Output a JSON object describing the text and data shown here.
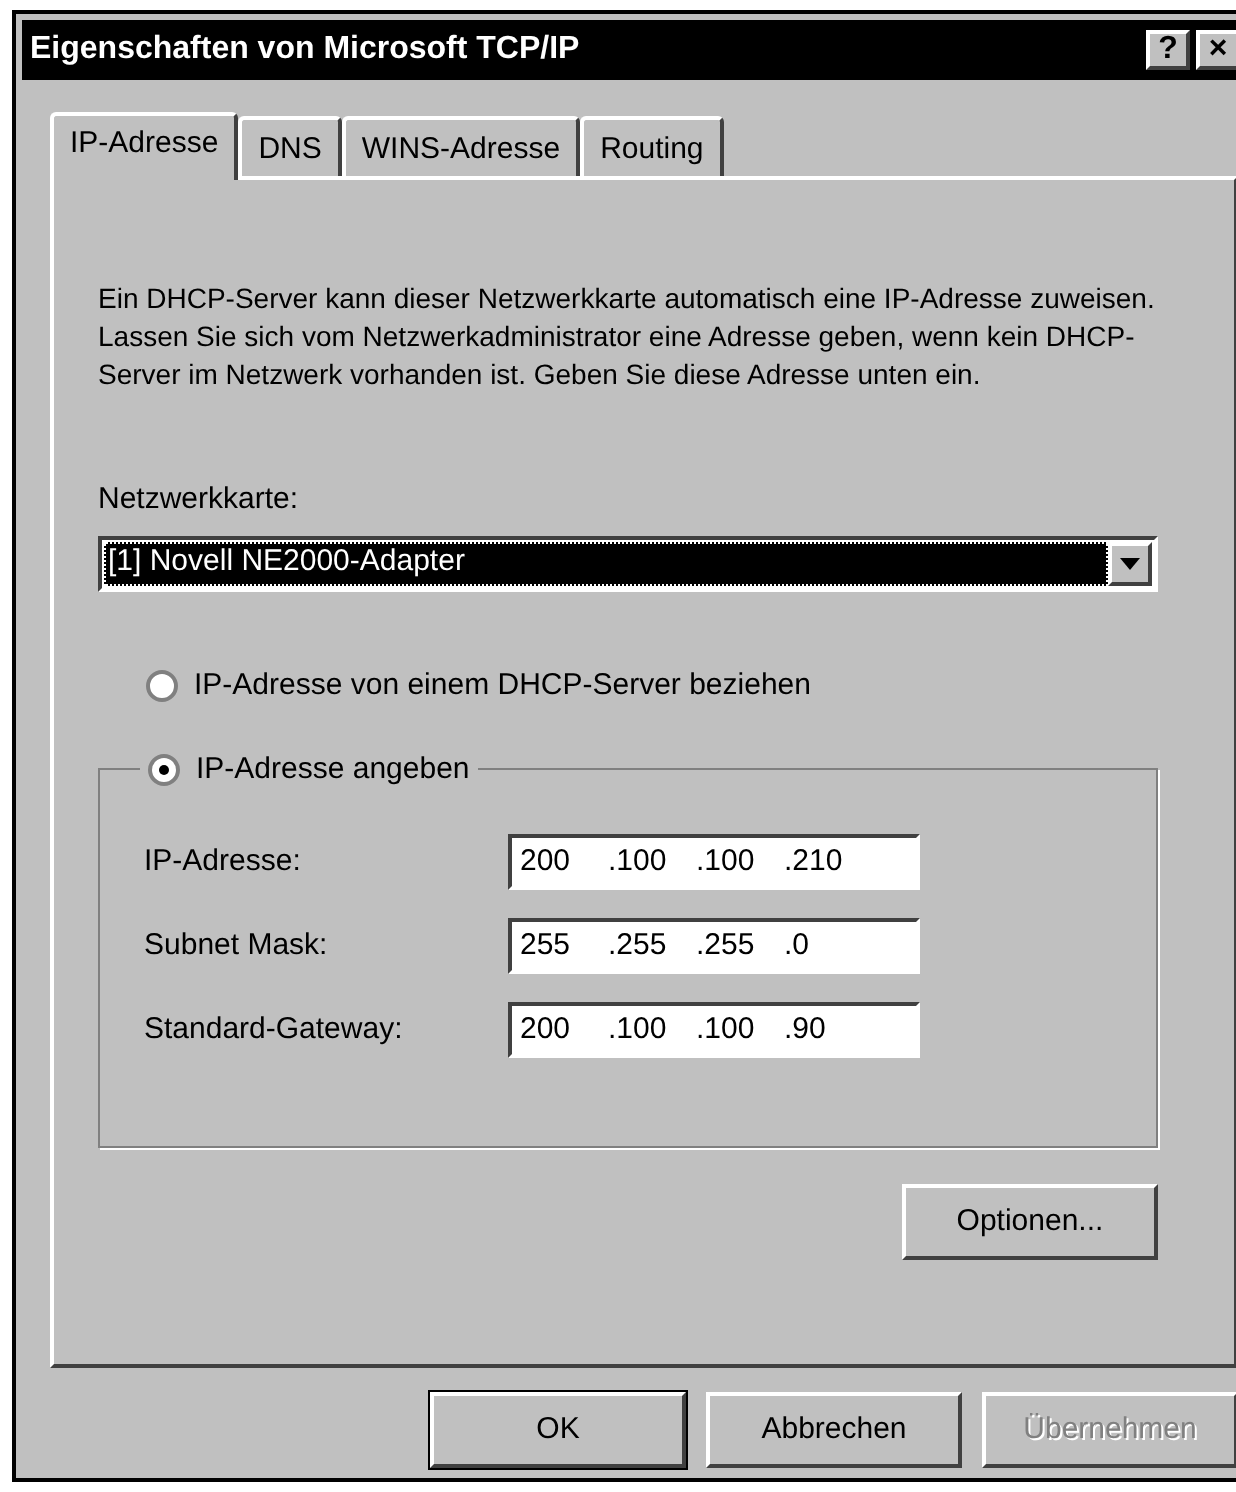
{
  "window": {
    "title": "Eigenschaften von Microsoft TCP/IP",
    "title_buttons": [
      {
        "kind": "help",
        "label": "?"
      },
      {
        "kind": "close",
        "label": "×"
      }
    ]
  },
  "tabs": [
    {
      "label": "IP-Adresse",
      "selected": true
    },
    {
      "label": "DNS",
      "selected": false
    },
    {
      "label": "WINS-Adresse",
      "selected": false
    },
    {
      "label": "Routing",
      "selected": false
    }
  ],
  "description": "Ein DHCP-Server kann dieser Netzwerkkarte automatisch eine IP-Adresse zuweisen. Lassen Sie sich vom Netzwerkadministrator eine Adresse geben, wenn kein DHCP-Server im Netzwerk vorhanden ist. Geben Sie diese Adresse unten ein.",
  "adapter": {
    "label": "Netzwerkkarte:",
    "value": "[1] Novell NE2000-Adapter",
    "focused": true
  },
  "radios": [
    {
      "label": "IP-Adresse von einem DHCP-Server beziehen",
      "selected": false
    },
    {
      "label": "IP-Adresse angeben",
      "selected": true
    }
  ],
  "fields": [
    {
      "label": "IP-Adresse:",
      "octets": [
        "200",
        ".100",
        ".100",
        ".210"
      ]
    },
    {
      "label": "Subnet Mask:",
      "octets": [
        "255",
        ".255",
        ".255",
        ".0"
      ]
    },
    {
      "label": "Standard-Gateway:",
      "octets": [
        "200",
        ".100",
        ".100",
        ".90"
      ]
    }
  ],
  "options_button": "Optionen...",
  "buttons": [
    {
      "label": "OK",
      "default": true,
      "disabled": false
    },
    {
      "label": "Abbrechen",
      "default": false,
      "disabled": false
    },
    {
      "label": "Übernehmen",
      "default": false,
      "disabled": true
    }
  ]
}
